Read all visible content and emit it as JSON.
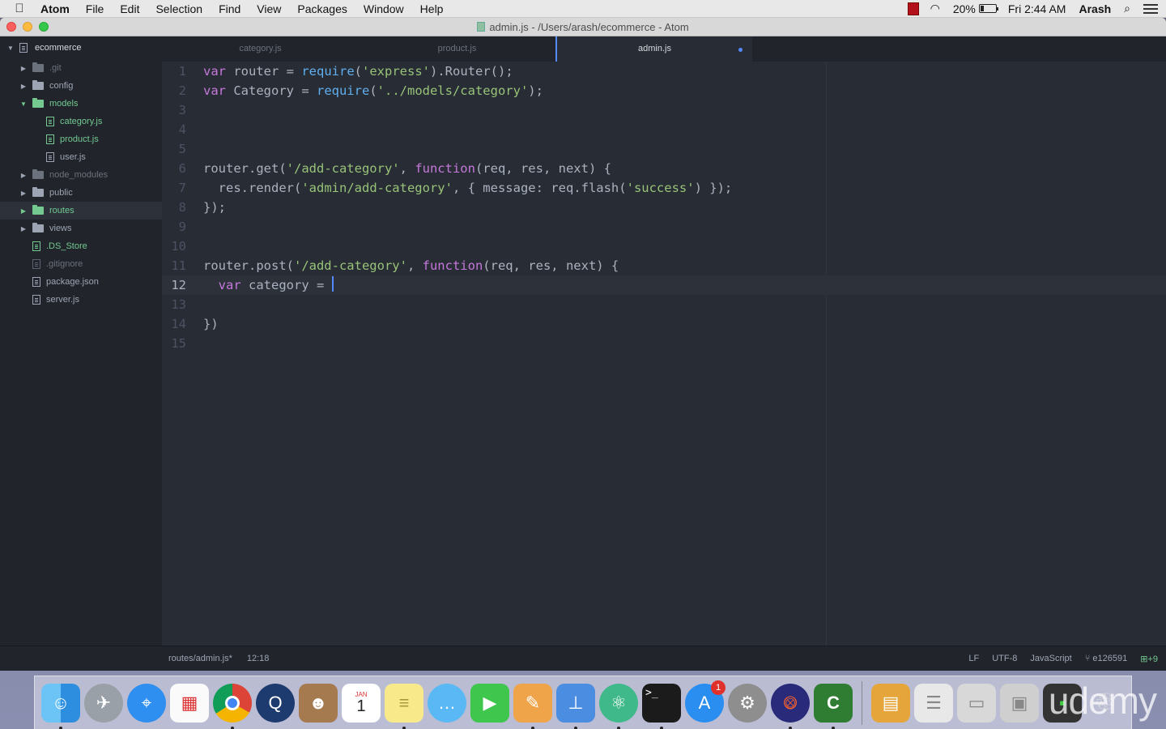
{
  "menubar": {
    "apple": "",
    "items": [
      "Atom",
      "File",
      "Edit",
      "Selection",
      "Find",
      "View",
      "Packages",
      "Window",
      "Help"
    ],
    "battery": "20%",
    "clock": "Fri 2:44 AM",
    "user": "Arash"
  },
  "window": {
    "title": "admin.js - /Users/arash/ecommerce - Atom"
  },
  "tree": {
    "root": "ecommerce",
    "items": [
      {
        "label": ".git"
      },
      {
        "label": "config"
      },
      {
        "label": "models"
      },
      {
        "label": "category.js"
      },
      {
        "label": "product.js"
      },
      {
        "label": "user.js"
      },
      {
        "label": "node_modules"
      },
      {
        "label": "public"
      },
      {
        "label": "routes"
      },
      {
        "label": "views"
      },
      {
        "label": ".DS_Store"
      },
      {
        "label": ".gitignore"
      },
      {
        "label": "package.json"
      },
      {
        "label": "server.js"
      }
    ]
  },
  "tabs": [
    {
      "label": "category.js"
    },
    {
      "label": "product.js"
    },
    {
      "label": "admin.js"
    }
  ],
  "editor": {
    "line_numbers": [
      "1",
      "2",
      "3",
      "4",
      "5",
      "6",
      "7",
      "8",
      "9",
      "10",
      "11",
      "12",
      "13",
      "14",
      "15"
    ],
    "current_line": "12",
    "code": [
      [
        "var",
        " router = ",
        "require",
        "(",
        "'express'",
        ").Router();"
      ],
      [
        "var",
        " Category = ",
        "require",
        "(",
        "'../models/category'",
        ");"
      ],
      [],
      [],
      [],
      [
        "router.get(",
        "'/add-category'",
        ", ",
        "function",
        "(req, res, next) {"
      ],
      [
        "  res.render(",
        "'admin/add-category'",
        ", { message: req.flash(",
        "'success'",
        ") });"
      ],
      [
        "});"
      ],
      [],
      [],
      [
        "router.post(",
        "'/add-category'",
        ", ",
        "function",
        "(req, res, next) {"
      ],
      [
        "  ",
        "var",
        " category = "
      ],
      [],
      [
        "})"
      ],
      []
    ]
  },
  "status": {
    "path": "routes/admin.js*",
    "cursor": "12:18",
    "line_ending": "LF",
    "encoding": "UTF-8",
    "grammar": "JavaScript",
    "git_branch": "e126591",
    "git_added": "+9"
  },
  "dock": {
    "calendar_month": "JAN",
    "calendar_day": "1",
    "appstore_badge": "1",
    "watermark": "udemy"
  }
}
